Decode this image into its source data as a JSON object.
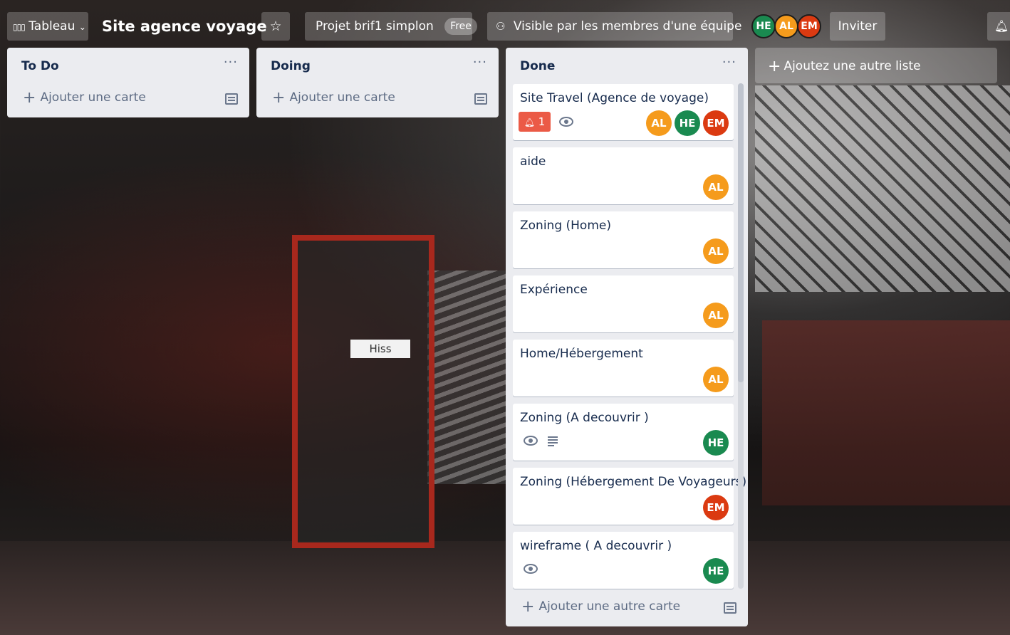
{
  "header": {
    "board_switcher_label": "Tableau",
    "board_title": "Site agence voyage",
    "workspace_label": "Projet brif1 simplon",
    "workspace_badge": "Free",
    "visibility_label": "Visible par les membres d'une équipe",
    "members": [
      "HE",
      "AL",
      "EM"
    ],
    "invite_label": "Inviter"
  },
  "lists": [
    {
      "title": "To Do",
      "add_card_label": "Ajouter une carte"
    },
    {
      "title": "Doing",
      "add_card_label": "Ajouter une carte"
    },
    {
      "title": "Done",
      "add_card_label": "Ajouter une autre carte",
      "cards": [
        {
          "title": "Site Travel (Agence de voyage)",
          "notification_count": "1",
          "members": [
            "AL",
            "HE",
            "EM"
          ]
        },
        {
          "title": "aide",
          "members": [
            "AL"
          ]
        },
        {
          "title": "Zoning (Home)",
          "members": [
            "AL"
          ]
        },
        {
          "title": "Expérience",
          "members": [
            "AL"
          ]
        },
        {
          "title": "Home/Hébergement",
          "members": [
            "AL"
          ]
        },
        {
          "title": "Zoning (A decouvrir )",
          "members": [
            "HE"
          ]
        },
        {
          "title": "Zoning (Hébergement De Voyageurs)",
          "members": [
            "EM"
          ]
        },
        {
          "title": "wireframe ( A decouvrir )",
          "members": [
            "HE"
          ]
        }
      ]
    }
  ],
  "add_list_label": "Ajoutez une autre liste",
  "background_sign": "Hiss",
  "colors": {
    "he": "#1a8a50",
    "al": "#f59b1c",
    "em": "#db3a11",
    "notification": "#eb5a46",
    "list_bg": "#ebecf0"
  }
}
